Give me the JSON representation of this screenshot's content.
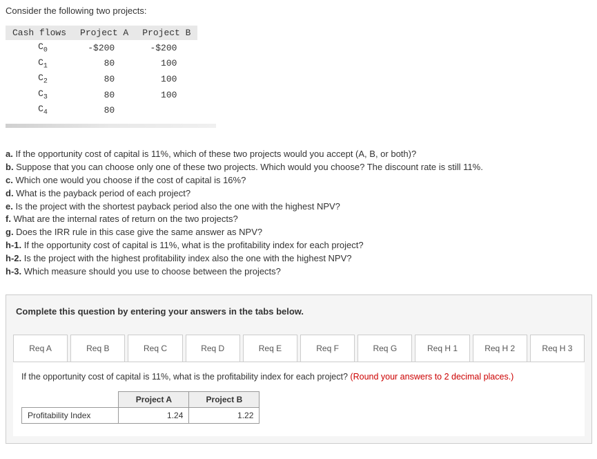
{
  "intro": "Consider the following two projects:",
  "cash_flow_table": {
    "headers": [
      "Cash flows",
      "Project A",
      "Project B"
    ],
    "rows": [
      {
        "label_base": "C",
        "label_sub": "0",
        "a": "-$200",
        "b": "-$200"
      },
      {
        "label_base": "C",
        "label_sub": "1",
        "a": "80",
        "b": "100"
      },
      {
        "label_base": "C",
        "label_sub": "2",
        "a": "80",
        "b": "100"
      },
      {
        "label_base": "C",
        "label_sub": "3",
        "a": "80",
        "b": "100"
      },
      {
        "label_base": "C",
        "label_sub": "4",
        "a": "80",
        "b": ""
      }
    ]
  },
  "questions": [
    {
      "letter": "a.",
      "text": "If the opportunity cost of capital is 11%, which of these two projects would you accept (A, B, or both)?"
    },
    {
      "letter": "b.",
      "text": "Suppose that you can choose only one of these two projects. Which would you choose? The discount rate is still 11%."
    },
    {
      "letter": "c.",
      "text": "Which one would you choose if the cost of capital is 16%?"
    },
    {
      "letter": "d.",
      "text": "What is the payback period of each project?"
    },
    {
      "letter": "e.",
      "text": "Is the project with the shortest payback period also the one with the highest NPV?"
    },
    {
      "letter": "f.",
      "text": "What are the internal rates of return on the two projects?"
    },
    {
      "letter": "g.",
      "text": "Does the IRR rule in this case give the same answer as NPV?"
    },
    {
      "letter": "h-1.",
      "text": "If the opportunity cost of capital is 11%, what is the profitability index for each project?"
    },
    {
      "letter": "h-2.",
      "text": "Is the project with the highest profitability index also the one with the highest NPV?"
    },
    {
      "letter": "h-3.",
      "text": "Which measure should you use to choose between the projects?"
    }
  ],
  "answer_prompt": "Complete this question by entering your answers in the tabs below.",
  "tabs": [
    "Req A",
    "Req B",
    "Req C",
    "Req D",
    "Req E",
    "Req F",
    "Req G",
    "Req H 1",
    "Req H 2",
    "Req H 3"
  ],
  "active_tab_content": {
    "instruction_black": "If the opportunity cost of capital is 11%, what is the profitability index for each project? ",
    "instruction_red": "(Round your answers to 2 decimal places.)",
    "table": {
      "headers": [
        "",
        "Project A",
        "Project B"
      ],
      "row_label": "Profitability Index",
      "value_a": "1.24",
      "value_b": "1.22"
    }
  }
}
